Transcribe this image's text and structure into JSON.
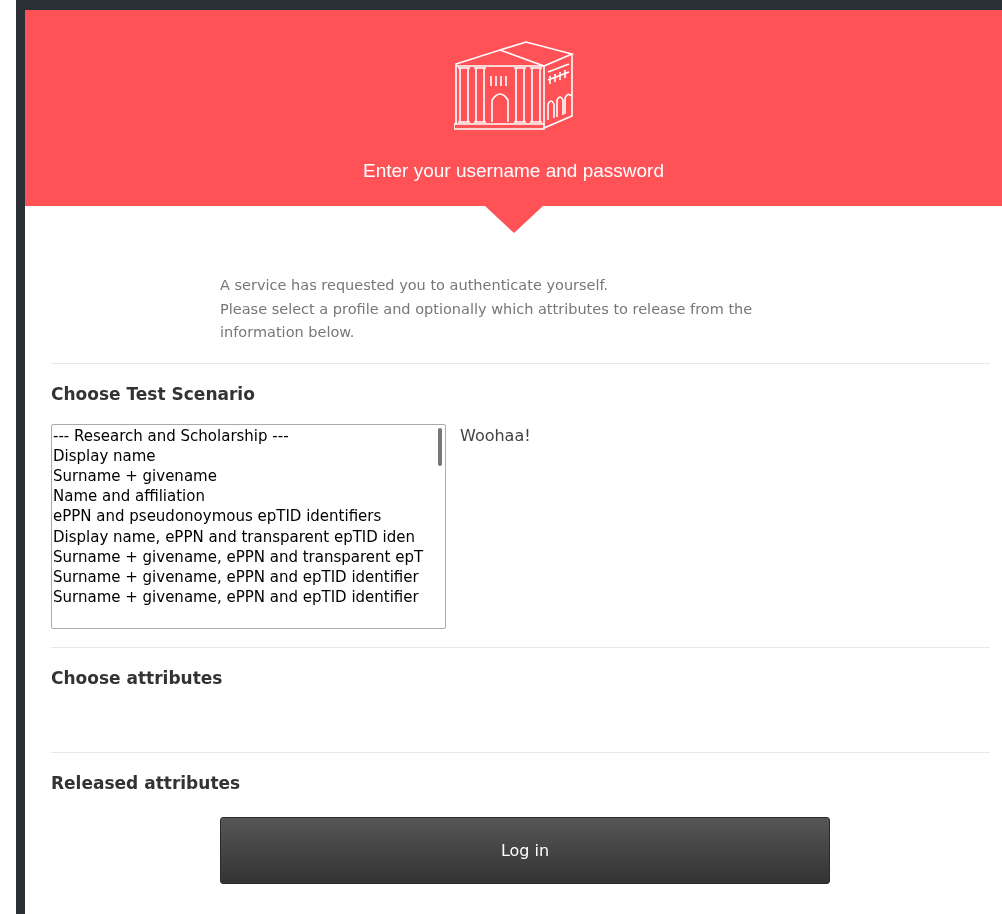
{
  "header": {
    "title": "Enter your username and password"
  },
  "intro": [
    "A service has requested you to authenticate yourself.",
    "Please select a profile and optionally which attributes to release from the information below."
  ],
  "scenario": {
    "heading": "Choose Test Scenario",
    "options": [
      {
        "label": "--- Research and Scholarship ---"
      },
      {
        "label": "Display name"
      },
      {
        "label": "Surname + givename"
      },
      {
        "label": "Name and affiliation"
      },
      {
        "label": "ePPN and pseudonoymous epTID identifiers"
      },
      {
        "label": "Display name, ePPN and transparent epTID iden"
      },
      {
        "label": "Surname + givename, ePPN and transparent epT"
      },
      {
        "label": "Surname + givename, ePPN and epTID identifier"
      },
      {
        "label": "Surname + givename, ePPN and epTID identifier"
      }
    ],
    "note": "Woohaa!"
  },
  "attributes": {
    "heading": "Choose attributes"
  },
  "released": {
    "heading": "Released attributes"
  },
  "login_button": "Log in"
}
